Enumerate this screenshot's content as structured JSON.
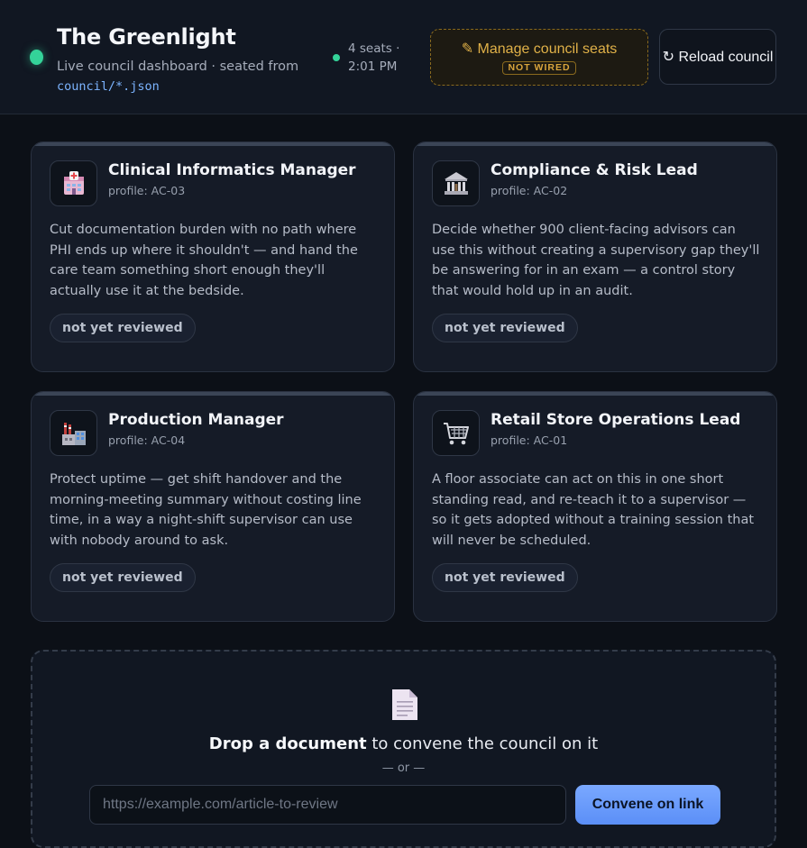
{
  "header": {
    "title": "The Greenlight",
    "subtitle": "Live council dashboard · seated from",
    "source_path": "council/*.json",
    "seats": "4 seats ·",
    "time": "2:01 PM",
    "manage_button": "✎ Manage council seats",
    "manage_badge": "NOT WIRED",
    "reload_button": "↻ Reload council"
  },
  "council": [
    {
      "name": "Clinical Informatics Manager",
      "profile": "profile: AC-03",
      "icon": "hospital-icon",
      "description": "Cut documentation burden with no path where PHI ends up where it shouldn't — and hand the care team something short enough they'll actually use it at the bedside.",
      "status": "not yet reviewed"
    },
    {
      "name": "Compliance & Risk Lead",
      "profile": "profile: AC-02",
      "icon": "bank-icon",
      "description": "Decide whether 900 client-facing advisors can use this without creating a supervisory gap they'll be answering for in an exam — a control story that would hold up in an audit.",
      "status": "not yet reviewed"
    },
    {
      "name": "Production Manager",
      "profile": "profile: AC-04",
      "icon": "factory-icon",
      "description": "Protect uptime — get shift handover and the morning-meeting summary without costing line time, in a way a night-shift supervisor can use with nobody around to ask.",
      "status": "not yet reviewed"
    },
    {
      "name": "Retail Store Operations Lead",
      "profile": "profile: AC-01",
      "icon": "shopping-cart-icon",
      "description": "A floor associate can act on this in one short standing read, and re-teach it to a supervisor — so it gets adopted without a training session that will never be scheduled.",
      "status": "not yet reviewed"
    }
  ],
  "dropzone": {
    "title_bold": "Drop a document",
    "title_rest": " to convene the council on it",
    "or": "— or —",
    "url_placeholder": "https://example.com/article-to-review",
    "convene_button": "Convene on link"
  },
  "colors": {
    "accent_green": "#34d399",
    "accent_amber": "#e0b148",
    "accent_blue": "#5b8ff7"
  }
}
